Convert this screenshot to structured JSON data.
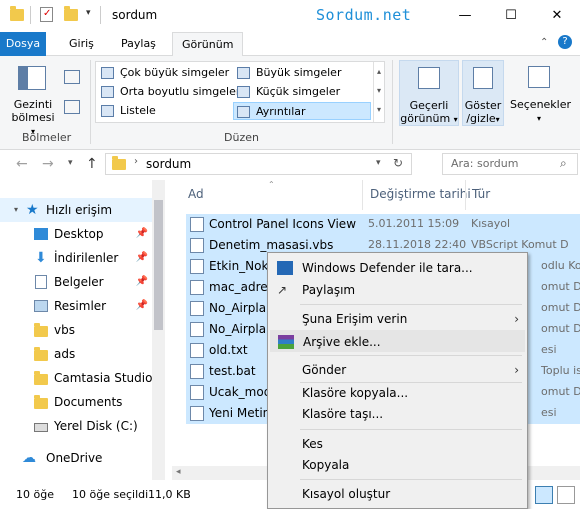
{
  "window": {
    "title": "sordum",
    "watermark": "Sordum.net",
    "minimize": "—",
    "maximize": "☐",
    "close": "✕"
  },
  "tabs": [
    {
      "label": "Dosya"
    },
    {
      "label": "Giriş"
    },
    {
      "label": "Paylaş"
    },
    {
      "label": "Görünüm"
    }
  ],
  "ribbon": {
    "nav_pane_label_1": "Gezinti",
    "nav_pane_label_2": "bölmesi",
    "panes_group": "Bölmeler",
    "layout_group": "Düzen",
    "layout_items": [
      "Çok büyük simgeler",
      "Büyük simgeler",
      "Orta boyutlu simgeler",
      "Küçük simgeler",
      "Listele",
      "Ayrıntılar"
    ],
    "current_view_1": "Geçerli",
    "current_view_2": "görünüm",
    "show_hide_1": "Göster",
    "show_hide_2": "/gizle",
    "options": "Seçenekler"
  },
  "address": {
    "path": "sordum",
    "search_placeholder": "Ara: sordum"
  },
  "nav": {
    "items": [
      {
        "label": "Hızlı erişim",
        "icon": "star-icon"
      },
      {
        "label": "Desktop",
        "icon": "desktop-icon"
      },
      {
        "label": "İndirilenler",
        "icon": "download-icon"
      },
      {
        "label": "Belgeler",
        "icon": "documents-icon"
      },
      {
        "label": "Resimler",
        "icon": "pictures-icon"
      },
      {
        "label": "vbs",
        "icon": "folder-icon"
      },
      {
        "label": "ads",
        "icon": "folder-icon"
      },
      {
        "label": "Camtasia Studio",
        "icon": "folder-icon"
      },
      {
        "label": "Documents",
        "icon": "folder-icon"
      },
      {
        "label": "Yerel Disk (C:)",
        "icon": "drive-icon"
      },
      {
        "label": "OneDrive",
        "icon": "cloud-icon"
      }
    ]
  },
  "columns": {
    "name": "Ad",
    "date": "Değiştirme tarihi",
    "type": "Tür"
  },
  "files": [
    {
      "name": "Control Panel Icons View",
      "date": "5.01.2011 15:09",
      "type": "Kısayol"
    },
    {
      "name": "Denetim_masasi.vbs",
      "date": "28.11.2018 22:40",
      "type": "VBScript Komut D"
    },
    {
      "name": "Etkin_Nokt",
      "date": "",
      "type": "odlu Ko"
    },
    {
      "name": "mac_adres.",
      "date": "",
      "type": "omut D"
    },
    {
      "name": "No_Airplan",
      "date": "",
      "type": "omut D"
    },
    {
      "name": "No_Airplan",
      "date": "",
      "type": "omut D"
    },
    {
      "name": "old.txt",
      "date": "",
      "type": "esi"
    },
    {
      "name": "test.bat",
      "date": "",
      "type": "Toplu is"
    },
    {
      "name": "Ucak_mod_",
      "date": "",
      "type": "omut D"
    },
    {
      "name": "Yeni Metin",
      "date": "",
      "type": "esi"
    }
  ],
  "status": {
    "count": "10 öğe",
    "selected": "10 öğe seçildi",
    "size": "11,0 KB"
  },
  "context_menu": {
    "items": [
      {
        "label": "Windows Defender ile tara...",
        "icon": "defender-icon"
      },
      {
        "label": "Paylaşım",
        "icon": "share-icon"
      },
      {
        "label": "Şuna Erişim verin",
        "submenu": true
      },
      {
        "label": "Arşive ekle...",
        "icon": "winrar-icon",
        "highlighted": true
      },
      {
        "label": "Gönder",
        "submenu": true
      },
      {
        "label": "Klasöre kopyala..."
      },
      {
        "label": "Klasöre taşı..."
      },
      {
        "label": "Kes"
      },
      {
        "label": "Kopyala"
      },
      {
        "label": "Kısayol oluştur"
      }
    ]
  }
}
